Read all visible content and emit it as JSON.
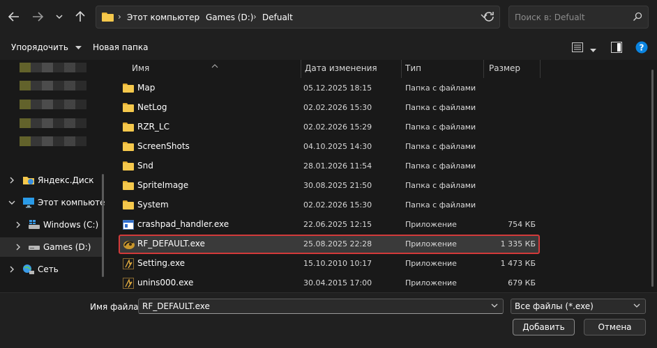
{
  "address": {
    "crumbs": [
      "Этот компьютер",
      "Games (D:)",
      "Defualt"
    ]
  },
  "search": {
    "placeholder": "Поиск в: Defualt"
  },
  "toolbar": {
    "organize_label": "Упорядочить",
    "new_folder_label": "Новая папка"
  },
  "sidebar": {
    "items": [
      {
        "label": "Яндекс.Диск",
        "icon": "yandex-disk-icon"
      },
      {
        "label": "Этот компьюте",
        "icon": "computer-icon"
      },
      {
        "label": "Windows (C:)",
        "icon": "windows-drive-icon"
      },
      {
        "label": "Games (D:)",
        "icon": "drive-icon"
      },
      {
        "label": "Сеть",
        "icon": "network-icon"
      }
    ]
  },
  "columns": {
    "name": "Имя",
    "date": "Дата изменения",
    "type": "Тип",
    "size": "Размер"
  },
  "files": [
    {
      "name": "Map",
      "date": "05.12.2025 18:15",
      "type": "Папка с файлами",
      "size": "",
      "icon": "folder-icon"
    },
    {
      "name": "NetLog",
      "date": "02.02.2026 15:30",
      "type": "Папка с файлами",
      "size": "",
      "icon": "folder-icon"
    },
    {
      "name": "RZR_LC",
      "date": "02.02.2026 15:29",
      "type": "Папка с файлами",
      "size": "",
      "icon": "folder-icon"
    },
    {
      "name": "ScreenShots",
      "date": "04.10.2025 14:30",
      "type": "Папка с файлами",
      "size": "",
      "icon": "folder-icon"
    },
    {
      "name": "Snd",
      "date": "28.01.2026 11:54",
      "type": "Папка с файлами",
      "size": "",
      "icon": "folder-icon"
    },
    {
      "name": "SpriteImage",
      "date": "30.08.2025 21:50",
      "type": "Папка с файлами",
      "size": "",
      "icon": "folder-icon"
    },
    {
      "name": "System",
      "date": "02.02.2026 15:30",
      "type": "Папка с файлами",
      "size": "",
      "icon": "folder-icon"
    },
    {
      "name": "crashpad_handler.exe",
      "date": "22.06.2025 12:15",
      "type": "Приложение",
      "size": "754 КБ",
      "icon": "exe-window-icon"
    },
    {
      "name": "RF_DEFAULT.exe",
      "date": "25.08.2025 22:28",
      "type": "Приложение",
      "size": "1 335 КБ",
      "icon": "rf-app-icon"
    },
    {
      "name": "Setting.exe",
      "date": "15.10.2010 10:17",
      "type": "Приложение",
      "size": "1 473 КБ",
      "icon": "setting-app-icon"
    },
    {
      "name": "unins000.exe",
      "date": "30.04.2015 17:00",
      "type": "Приложение",
      "size": "679 КБ",
      "icon": "uninstall-app-icon"
    }
  ],
  "footer": {
    "filename_label": "Имя файла:",
    "filename_value": "RF_DEFAULT.exe",
    "filetype_value": "Все файлы (*.exe)",
    "add_label": "Добавить",
    "cancel_label": "Отмена"
  },
  "colors": {
    "highlight_border": "#d33a3a",
    "folder": "#f5c84c",
    "accent_help": "#0a84e0"
  }
}
